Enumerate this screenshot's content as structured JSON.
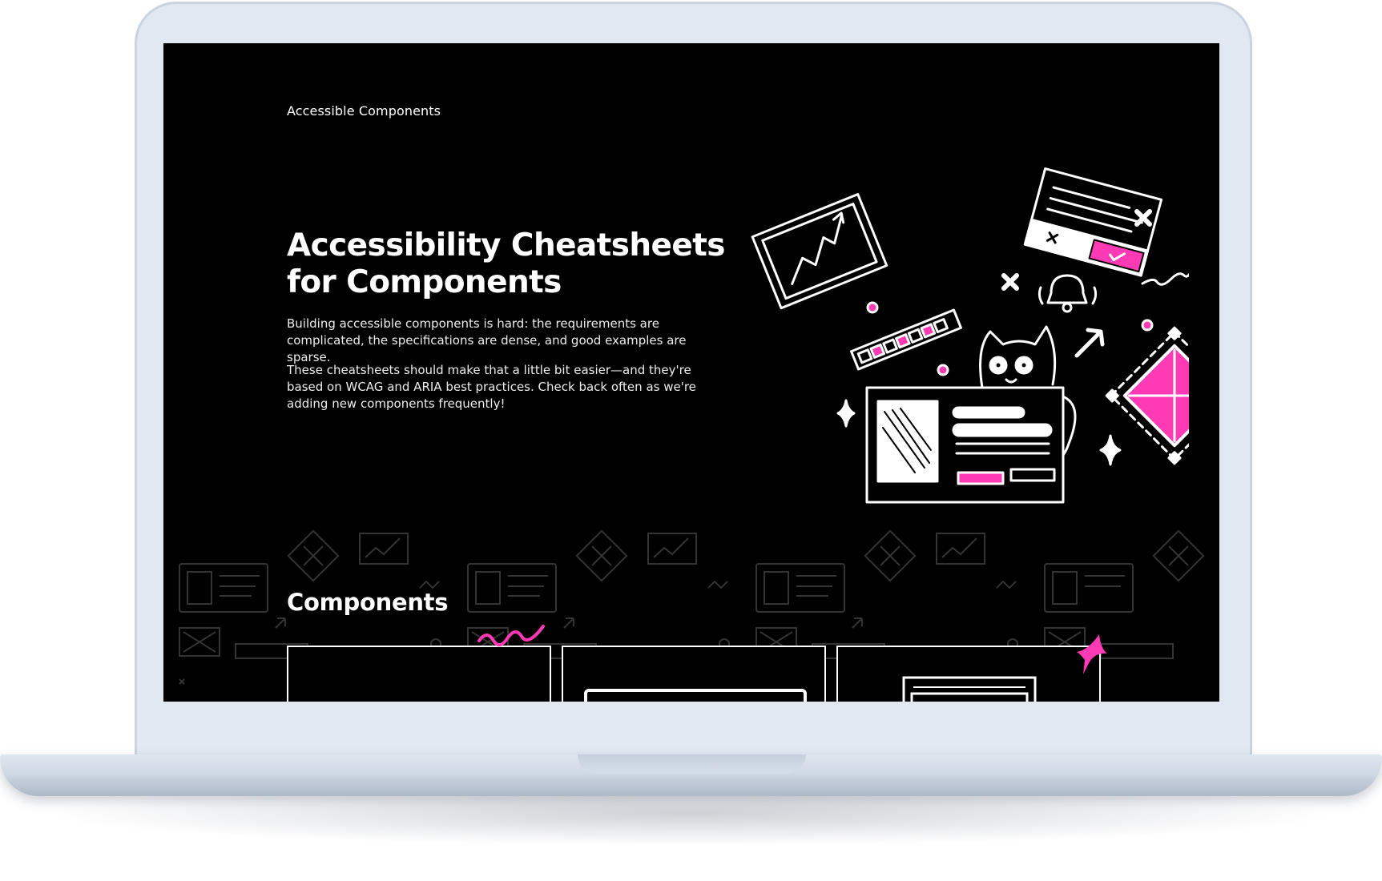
{
  "site": {
    "name": "Accessible Components"
  },
  "hero": {
    "title": "Accessibility Cheatsheets for Components",
    "paragraphs": [
      "Building accessible components is hard: the requirements are complicated, the specifications are dense, and good examples are sparse.",
      "These cheatsheets should make that a little bit easier—and they're based on WCAG and ARIA best practices. Check back often as we're adding new components frequently!"
    ],
    "illustration_icon": "cat-with-ui-elements-illustration"
  },
  "components_section": {
    "title": "Components",
    "cards": [
      {
        "icon": "blank-card-preview"
      },
      {
        "icon": "button-preview-icon"
      },
      {
        "icon": "window-preview-icon"
      }
    ]
  },
  "colors": {
    "background": "#000000",
    "text": "#ffffff",
    "accent": "#ff3ab4",
    "device_frame": "#e2e8f1"
  }
}
